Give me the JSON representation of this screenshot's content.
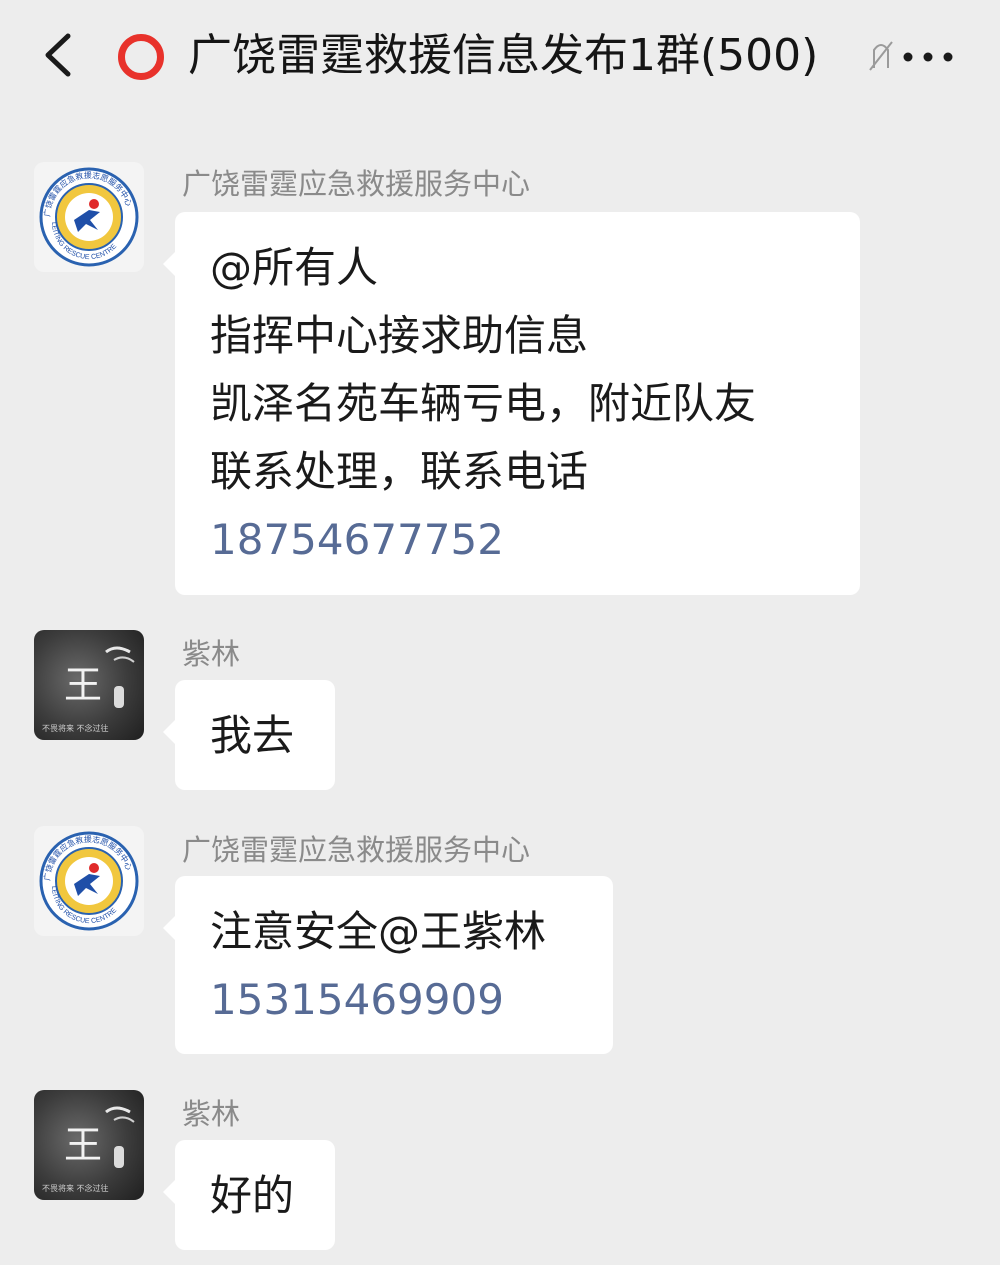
{
  "header": {
    "title": "广饶雷霆救援信息发布1群(500)",
    "mute_glyph": "ᐝ",
    "icons": {
      "back": "chevron-left-icon",
      "status": "red-ring-icon",
      "more": "more-dots-icon"
    },
    "accent_color": "#e8322b"
  },
  "logo": {
    "ring_text": "广饶雷霆应急救援志愿服务中心",
    "english_text": "LEITING RESCUE CENTRE"
  },
  "user_avatar": {
    "glyph": "王",
    "tagline": "不畏将来 不念过往"
  },
  "colors": {
    "link": "#576b95",
    "bubble": "#ffffff",
    "background": "#ededed"
  },
  "messages": [
    {
      "sender": "广饶雷霆应急救援服务中心",
      "lines": [
        "@所有人",
        "指挥中心接求助信息",
        "凯泽名苑车辆亏电，附近队友",
        "联系处理，联系电话"
      ],
      "phone": "18754677752"
    },
    {
      "sender": "紫林",
      "lines": [
        "我去"
      ]
    },
    {
      "sender": "广饶雷霆应急救援服务中心",
      "lines": [
        "注意安全@王紫林"
      ],
      "phone": "15315469909"
    },
    {
      "sender": "紫林",
      "lines": [
        "好的"
      ]
    }
  ]
}
